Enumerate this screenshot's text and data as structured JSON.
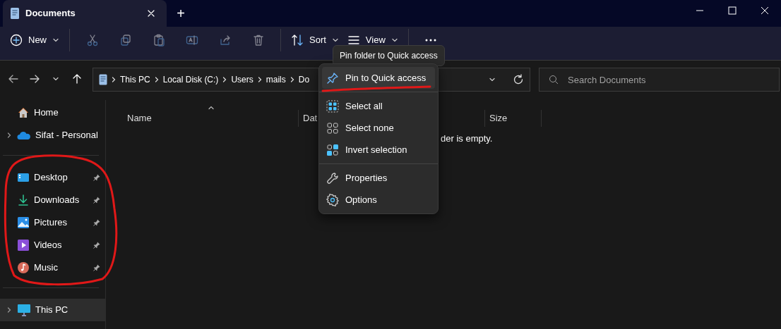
{
  "window": {
    "tab_title": "Documents",
    "new_tab": "+"
  },
  "toolbar": {
    "buttons": [
      {
        "kind": "new",
        "label": "New",
        "disabled": false
      },
      {
        "kind": "cut",
        "disabled": true
      },
      {
        "kind": "copy",
        "disabled": true
      },
      {
        "kind": "paste",
        "disabled": true
      },
      {
        "kind": "rename",
        "disabled": true
      },
      {
        "kind": "share",
        "disabled": true
      },
      {
        "kind": "delete",
        "disabled": true
      },
      {
        "kind": "sort",
        "label": "Sort",
        "disabled": false
      },
      {
        "kind": "view",
        "label": "View",
        "disabled": false
      },
      {
        "kind": "more",
        "disabled": false
      }
    ]
  },
  "address_bar": {
    "crumbs": [
      "This PC",
      "Local Disk (C:)",
      "Users",
      "mails",
      "Do"
    ]
  },
  "search": {
    "placeholder": "Search Documents"
  },
  "sidebar": {
    "groups": [
      [
        {
          "kind": "home",
          "label": "Home",
          "expandable": false,
          "pinned": false,
          "selected": false
        },
        {
          "kind": "cloud",
          "label": "Sifat - Personal",
          "expandable": true,
          "pinned": false,
          "selected": false
        }
      ],
      [
        {
          "kind": "desktop",
          "label": "Desktop",
          "expandable": false,
          "pinned": true,
          "selected": false
        },
        {
          "kind": "downloads",
          "label": "Downloads",
          "expandable": false,
          "pinned": true,
          "selected": false
        },
        {
          "kind": "pictures",
          "label": "Pictures",
          "expandable": false,
          "pinned": true,
          "selected": false
        },
        {
          "kind": "videos",
          "label": "Videos",
          "expandable": false,
          "pinned": true,
          "selected": false
        },
        {
          "kind": "music",
          "label": "Music",
          "expandable": false,
          "pinned": true,
          "selected": false
        }
      ],
      [
        {
          "kind": "pc",
          "label": "This PC",
          "expandable": true,
          "pinned": false,
          "selected": true
        }
      ]
    ]
  },
  "columns": [
    {
      "label": "Name",
      "sorted": true
    },
    {
      "label": "Dat",
      "sorted": false
    },
    {
      "label": "Size",
      "sorted": false
    }
  ],
  "empty_message": "der is empty.",
  "tooltip": "Pin folder to Quick access",
  "menu": {
    "groups": [
      [
        {
          "kind": "pin",
          "label": "Pin to Quick access",
          "selected": true
        }
      ],
      [
        {
          "kind": "select-all",
          "label": "Select all",
          "selected": false
        },
        {
          "kind": "select-none",
          "label": "Select none",
          "selected": false
        },
        {
          "kind": "invert",
          "label": "Invert selection",
          "selected": false
        }
      ],
      [
        {
          "kind": "properties",
          "label": "Properties",
          "selected": false
        },
        {
          "kind": "options",
          "label": "Options",
          "selected": false
        }
      ]
    ]
  }
}
